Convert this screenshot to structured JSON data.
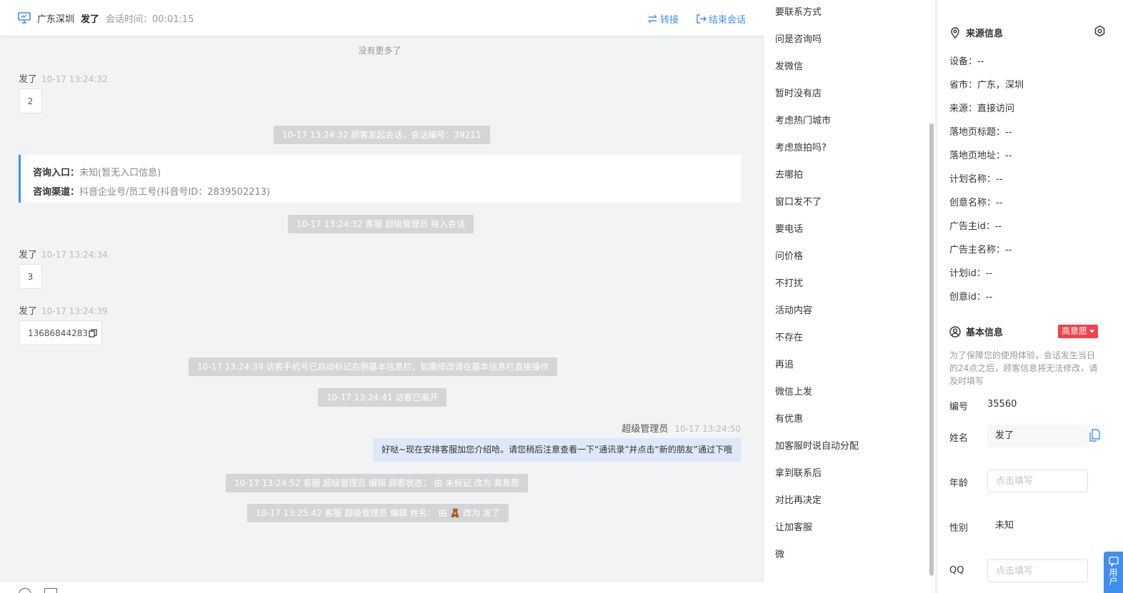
{
  "header": {
    "location": "广东深圳",
    "visitor_name": "发了",
    "session_time_label": "会话时间：00:01:15",
    "transfer_label": "转接",
    "end_label": "结束会话"
  },
  "chat": {
    "no_more": "没有更多了",
    "messages": [
      {
        "sender": "发了",
        "time": "10-17 13:24:32",
        "text": "2"
      },
      {
        "sender": "发了",
        "time": "10-17 13:24:34",
        "text": "3"
      },
      {
        "sender": "发了",
        "time": "10-17 13:24:39",
        "text": "13686844283"
      }
    ],
    "system": [
      "10-17 13:24:32 顾客发起会话，会话编号：39211",
      "10-17 13:24:32 客服 超级管理员 接入会话",
      "10-17 13:24:39 访客手机号已自动标记右侧基本信息栏，如需修改请在基本信息栏直接操作",
      "10-17 13:24:41 访客已离开",
      "10-17 13:24:52 客服 超级管理员 编辑 顾客状态： 由 未标记 改为 高意愿",
      "10-17 13:25:42 客服 超级管理员 编辑 姓名： 由 🧸 改为 发了"
    ],
    "entry": {
      "label1": "咨询入口：",
      "value1": "未知(暂无入口信息)",
      "label2": "咨询渠道：",
      "value2": "抖音企业号/员工号(抖音号ID：2839502213)"
    },
    "agent": {
      "name": "超级管理员",
      "time": "10-17 13:24:50",
      "text": "好哒~现在安排客服加您介绍哈。请您稍后注意查看一下“通讯录”并点击“新的朋友”通过下哦"
    }
  },
  "quick_replies": [
    "要联系方式",
    "问是咨询吗",
    "发微信",
    "暂时没有店",
    "考虑热门城市",
    "考虑旅拍吗?",
    "去哪拍",
    "窗口发不了",
    "要电话",
    "问价格",
    "不打扰",
    "活动内容",
    "不存在",
    "再追",
    "微信上发",
    "有优惠",
    "加客服时说自动分配",
    "拿到联系后",
    "对比再决定",
    "让加客服",
    "微"
  ],
  "source_info": {
    "title": "来源信息",
    "rows": [
      "设备：--",
      "省市：广东，深圳",
      "来源：直接访问",
      "落地页标题：--",
      "落地页地址：--",
      "计划名称：--",
      "创意名称：--",
      "广告主id：--",
      "广告主名称：--",
      "计划id：--",
      "创意id：--"
    ]
  },
  "basic_info": {
    "title": "基本信息",
    "badge": "高意愿",
    "note": "为了保障您的使用体验，会话发生当日的24点之后，顾客信息将无法修改，请及时填写",
    "id_label": "编号",
    "id_value": "35560",
    "name_label": "姓名",
    "name_value": "发了",
    "age_label": "年龄",
    "age_placeholder": "点击填写",
    "gender_label": "性别",
    "gender_value": "未知",
    "qq_label": "QQ",
    "qq_placeholder": "点击填写"
  },
  "floating": {
    "label": "用户"
  },
  "colors": {
    "accent": "#3f8ff0",
    "badge": "#f0424b",
    "agent_bubble": "#dde8f9",
    "system_bg": "#d4d5d7"
  }
}
